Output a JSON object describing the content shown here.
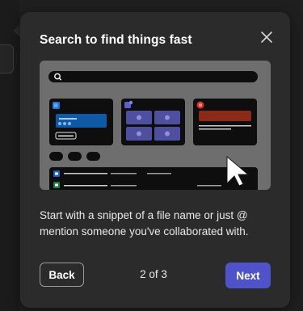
{
  "callout": {
    "title": "Search to find things fast",
    "description": "Start with a snippet of a file name or just @ mention someone you've collaborated with.",
    "back_label": "Back",
    "next_label": "Next",
    "pager": "2 of 3",
    "close_icon": "close-icon"
  },
  "colors": {
    "card_bg": "#2b2b2b",
    "primary_button": "#4f52c9",
    "illustration_bg": "#6e6e6e",
    "illustration_tile": "#0e0e0e",
    "teams_tile": "#4e4f9e",
    "office_tile": "#8b2a19",
    "word_blue": "#1f5fb7"
  },
  "illustration": {
    "name": "search-tutorial-illustration",
    "icons": [
      "search-icon",
      "outlook-icon",
      "teams-icon",
      "office-icon",
      "word-icon",
      "excel-icon",
      "cursor-arrow-icon"
    ]
  }
}
